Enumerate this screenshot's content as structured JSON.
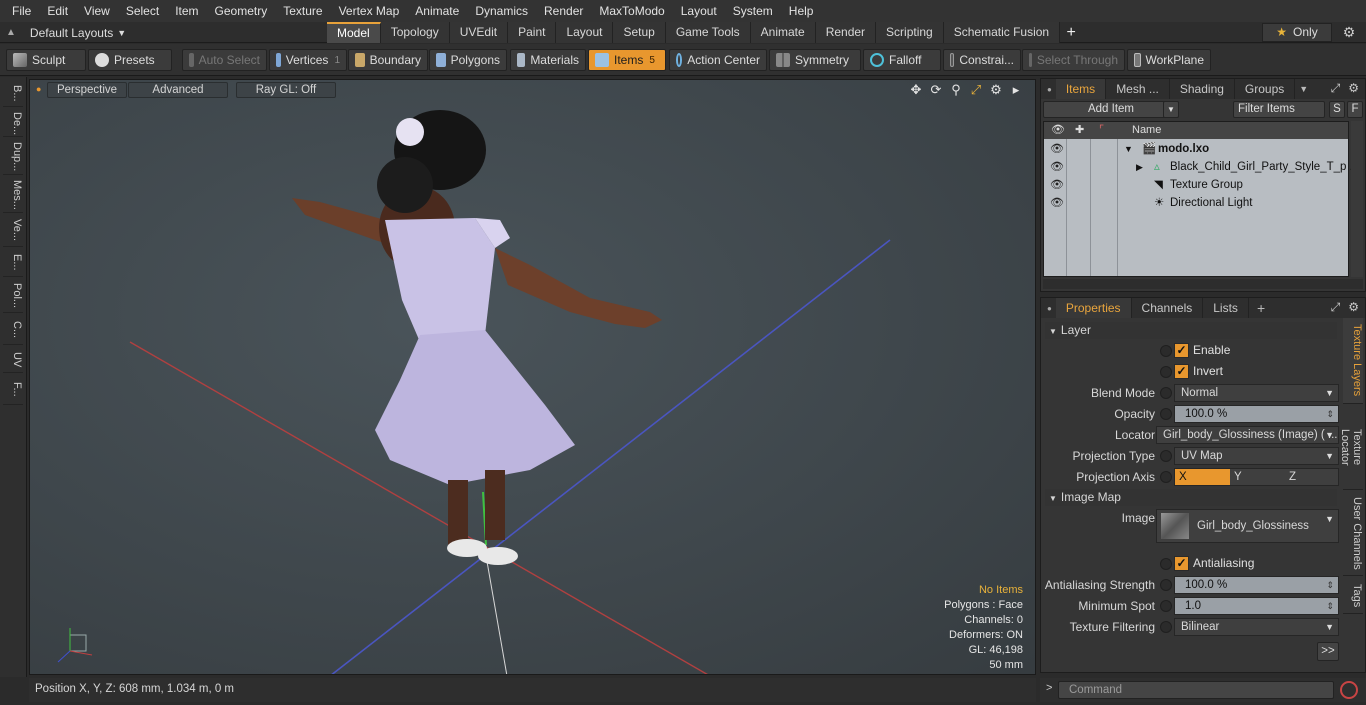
{
  "menu": [
    "File",
    "Edit",
    "View",
    "Select",
    "Item",
    "Geometry",
    "Texture",
    "Vertex Map",
    "Animate",
    "Dynamics",
    "Render",
    "MaxToModo",
    "Layout",
    "System",
    "Help"
  ],
  "layouts": {
    "default_layouts": "Default Layouts",
    "tabs": [
      "Model",
      "Topology",
      "UVEdit",
      "Paint",
      "Layout",
      "Setup",
      "Game Tools",
      "Animate",
      "Render",
      "Scripting",
      "Schematic Fusion"
    ],
    "active_tab": "Model",
    "only": "Only"
  },
  "toolbar": {
    "sculpt": "Sculpt",
    "presets": "Presets",
    "auto_select": "Auto Select",
    "vertices": "Vertices",
    "vertices_count": "1",
    "boundary": "Boundary",
    "polygons": "Polygons",
    "materials": "Materials",
    "items": "Items",
    "items_count": "5",
    "action_center": "Action Center",
    "symmetry": "Symmetry",
    "falloff": "Falloff",
    "constraints": "Constrai...",
    "select_through": "Select Through",
    "workplane": "WorkPlane"
  },
  "left_tabs": [
    "B...",
    "De...",
    "Dup...",
    "Mes...",
    "Ve...",
    "E...",
    "Pol...",
    "C...",
    "UV",
    "F..."
  ],
  "viewport": {
    "perspective": "Perspective",
    "advanced": "Advanced",
    "raygl": "Ray GL: Off",
    "info": {
      "no_items": "No Items",
      "polygons": "Polygons : Face",
      "channels": "Channels: 0",
      "deformers": "Deformers: ON",
      "gl": "GL: 46,198",
      "focal": "50 mm"
    }
  },
  "status": {
    "position": "Position X, Y, Z:  608 mm, 1.034 m, 0 m"
  },
  "items_panel": {
    "tabs": [
      "Items",
      "Mesh ...",
      "Shading",
      "Groups"
    ],
    "active_tab": "Items",
    "add_item": "Add Item",
    "filter_items": "Filter Items",
    "s_btn": "S",
    "f_btn": "F",
    "name_header": "Name",
    "rows": [
      {
        "name": "modo.lxo"
      },
      {
        "name": "Black_Child_Girl_Party_Style_T_p ..."
      },
      {
        "name": "Texture Group"
      },
      {
        "name": "Directional Light"
      }
    ]
  },
  "properties": {
    "tabs": [
      "Properties",
      "Channels",
      "Lists"
    ],
    "active_tab": "Properties",
    "layer_section": "Layer",
    "enable": "Enable",
    "invert": "Invert",
    "blend_mode_label": "Blend Mode",
    "blend_mode": "Normal",
    "opacity_label": "Opacity",
    "opacity": "100.0 %",
    "locator_label": "Locator",
    "locator": "Girl_body_Glossiness (Image) ( ...",
    "projection_type_label": "Projection Type",
    "projection_type": "UV Map",
    "projection_axis_label": "Projection Axis",
    "axis_x": "X",
    "axis_y": "Y",
    "axis_z": "Z",
    "image_map_section": "Image Map",
    "image_label": "Image",
    "image": "Girl_body_Glossiness",
    "antialiasing": "Antialiasing",
    "aa_strength_label": "Antialiasing Strength",
    "aa_strength": "100.0 %",
    "min_spot_label": "Minimum Spot",
    "min_spot": "1.0",
    "tex_filter_label": "Texture Filtering",
    "tex_filter": "Bilinear",
    "more": ">>"
  },
  "right_vtabs": [
    "Texture Layers",
    "Texture Locator",
    "User Channels",
    "Tags"
  ],
  "command": {
    "placeholder": "Command"
  },
  "colors": {
    "accent": "#e8972e",
    "viewport_bg": "#3f474c",
    "dress": "#c9c2e6"
  }
}
